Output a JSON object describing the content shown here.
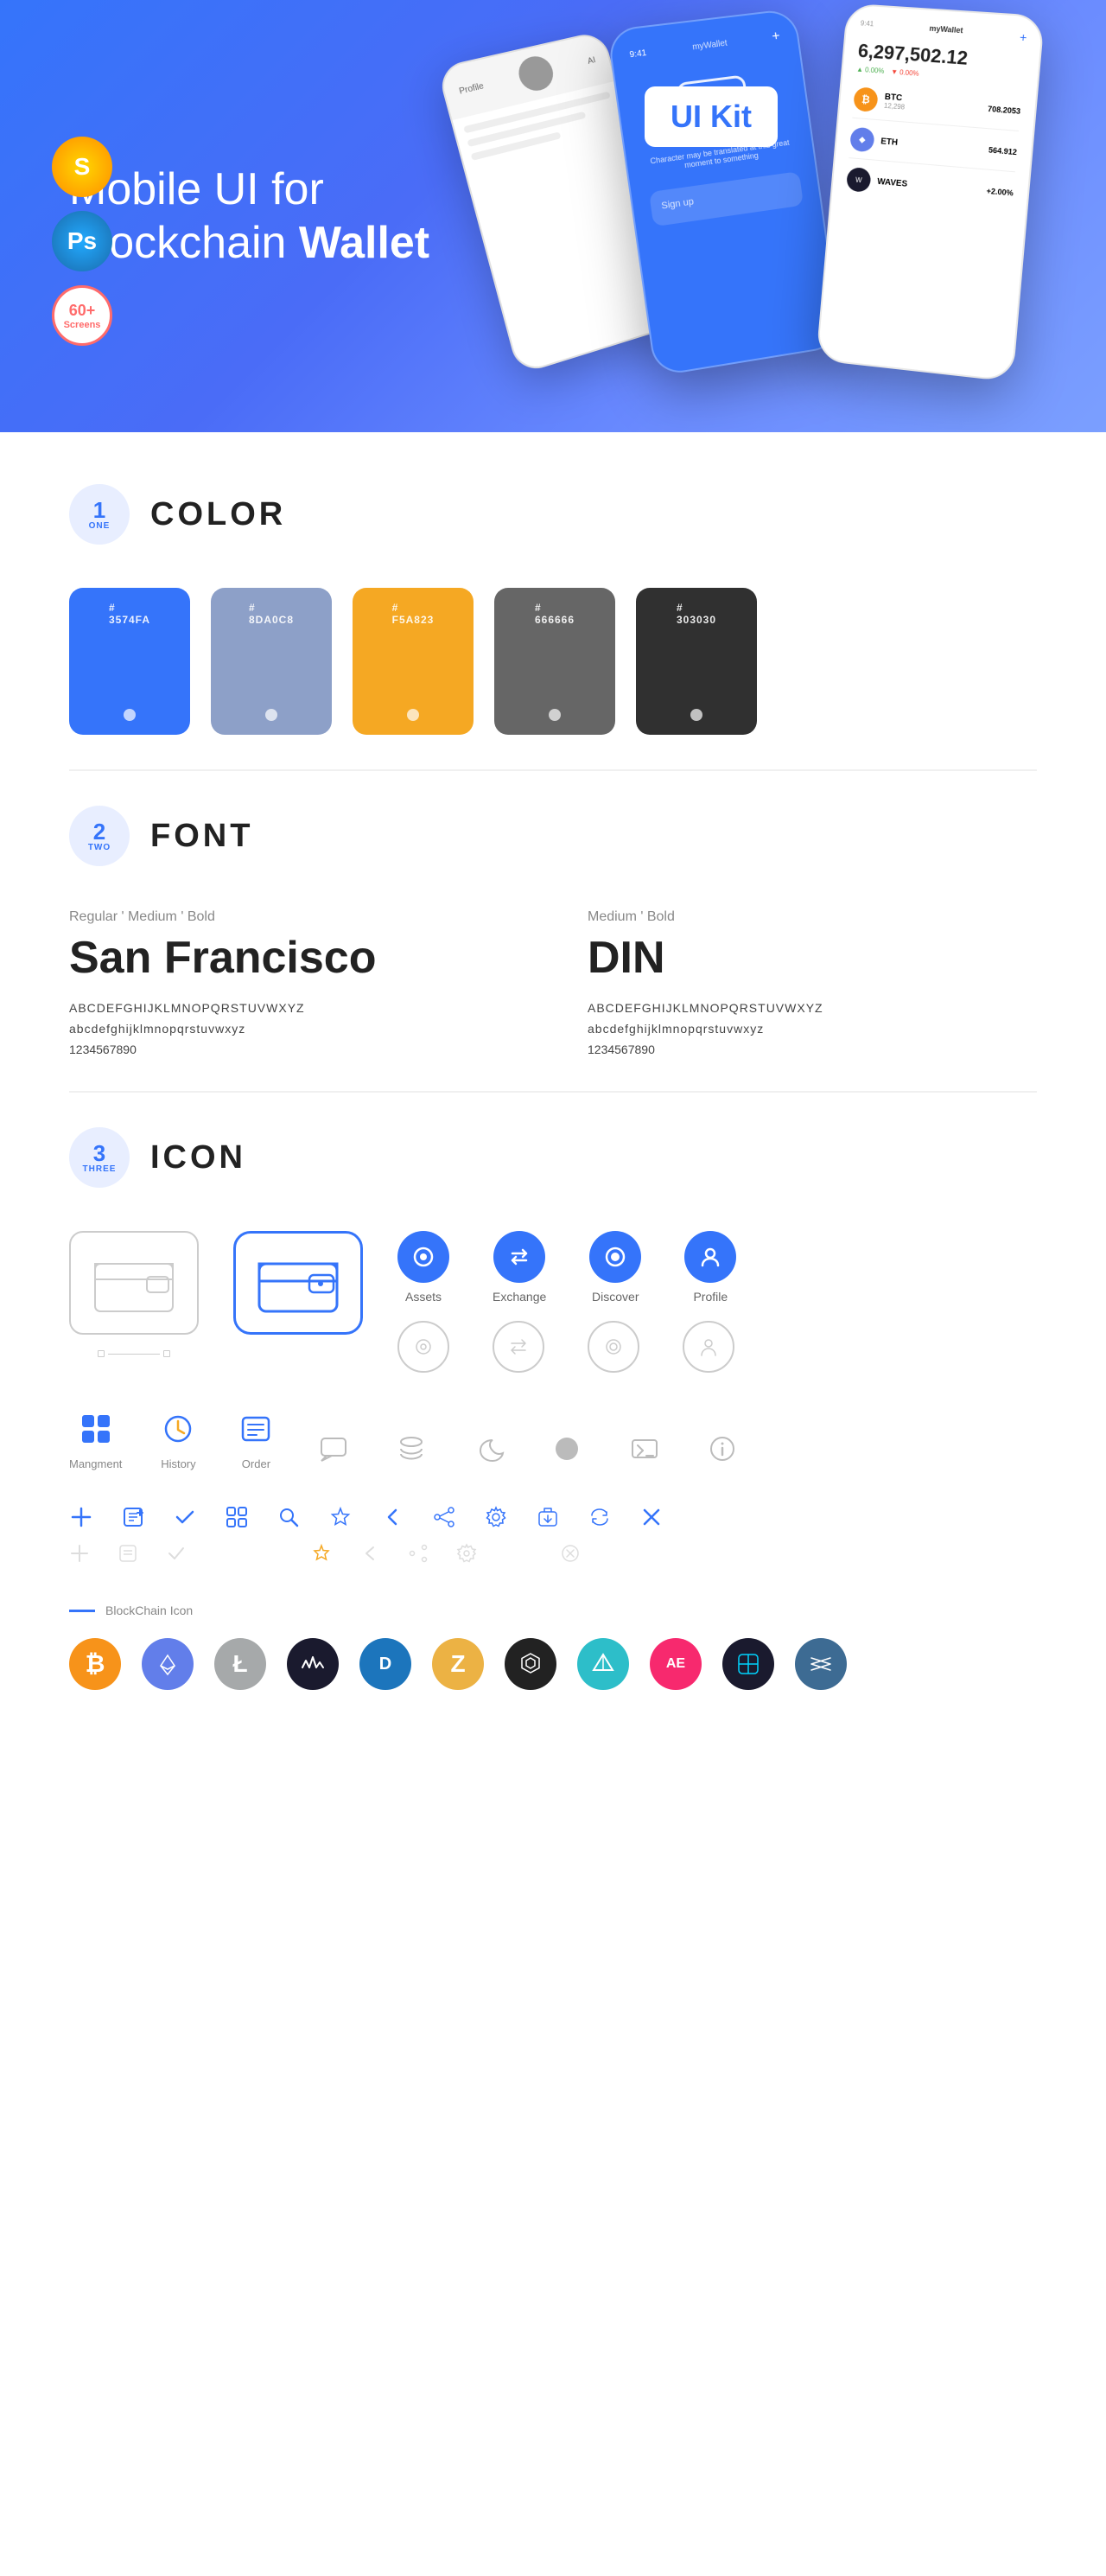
{
  "hero": {
    "title": "Mobile UI for Blockchain ",
    "title_bold": "Wallet",
    "ui_kit_label": "UI Kit",
    "tools": [
      {
        "name": "Sketch",
        "label": "S"
      },
      {
        "name": "Photoshop",
        "label": "Ps"
      },
      {
        "name": "Screens",
        "count": "60+",
        "sub": "Screens"
      }
    ]
  },
  "sections": {
    "color": {
      "number": "1",
      "word": "ONE",
      "title": "COLOR",
      "swatches": [
        {
          "hex": "#3574FA",
          "label": "3574FA",
          "class": "swatch-blue"
        },
        {
          "hex": "#8DA0C8",
          "label": "8DA0C8",
          "class": "swatch-lightblue"
        },
        {
          "hex": "#F5A823",
          "label": "F5A823",
          "class": "swatch-orange"
        },
        {
          "hex": "#666666",
          "label": "666666",
          "class": "swatch-gray"
        },
        {
          "hex": "#303030",
          "label": "303030",
          "class": "swatch-dark"
        }
      ]
    },
    "font": {
      "number": "2",
      "word": "TWO",
      "title": "FONT",
      "fonts": [
        {
          "style_label": "Regular ' Medium ' Bold",
          "name": "San Francisco",
          "uppercase": "ABCDEFGHIJKLMNOPQRSTUVWXYZ",
          "lowercase": "abcdefghijklmnopqrstuvwxyz",
          "numbers": "1234567890"
        },
        {
          "style_label": "Medium ' Bold",
          "name": "DIN",
          "uppercase": "ABCDEFGHIJKLMNOPQRSTUVWXYZ",
          "lowercase": "abcdefghijklmnopqrstuvwxyz",
          "numbers": "1234567890"
        }
      ]
    },
    "icon": {
      "number": "3",
      "word": "THREE",
      "title": "ICON",
      "nav_icons": [
        {
          "label": "Assets",
          "symbol": "◈"
        },
        {
          "label": "Exchange",
          "symbol": "↔"
        },
        {
          "label": "Discover",
          "symbol": "●"
        },
        {
          "label": "Profile",
          "symbol": "⌂"
        }
      ],
      "bottom_nav": [
        {
          "label": "Mangment",
          "symbol": "▦"
        },
        {
          "label": "History",
          "symbol": "⊙"
        },
        {
          "label": "Order",
          "symbol": "☰"
        }
      ],
      "tool_icons": [
        "＋",
        "⊞",
        "✓",
        "⊞",
        "⌕",
        "✦",
        "‹",
        "⌤",
        "⚙",
        "⊡",
        "⇄",
        "✕"
      ],
      "blockchain_label": "BlockChain Icon",
      "blockchain_icons": [
        {
          "name": "Bitcoin",
          "symbol": "₿",
          "class": "bc-bitcoin"
        },
        {
          "name": "Ethereum",
          "symbol": "◆",
          "class": "bc-eth"
        },
        {
          "name": "Litecoin",
          "symbol": "Ł",
          "class": "bc-ltc"
        },
        {
          "name": "Waves",
          "symbol": "〜",
          "class": "bc-waves"
        },
        {
          "name": "Dash",
          "symbol": "D",
          "class": "bc-dash"
        },
        {
          "name": "Zcash",
          "symbol": "Z",
          "class": "bc-zcash"
        },
        {
          "name": "Network",
          "symbol": "⬡",
          "class": "bc-net"
        },
        {
          "name": "Aragon",
          "symbol": "▲",
          "class": "bc-aragon"
        },
        {
          "name": "AE",
          "symbol": "Æ",
          "class": "bc-ae"
        },
        {
          "name": "Gnosis",
          "symbol": "∞",
          "class": "bc-gnosis"
        },
        {
          "name": "Stellar",
          "symbol": "✦",
          "class": "bc-stellar"
        }
      ]
    }
  }
}
